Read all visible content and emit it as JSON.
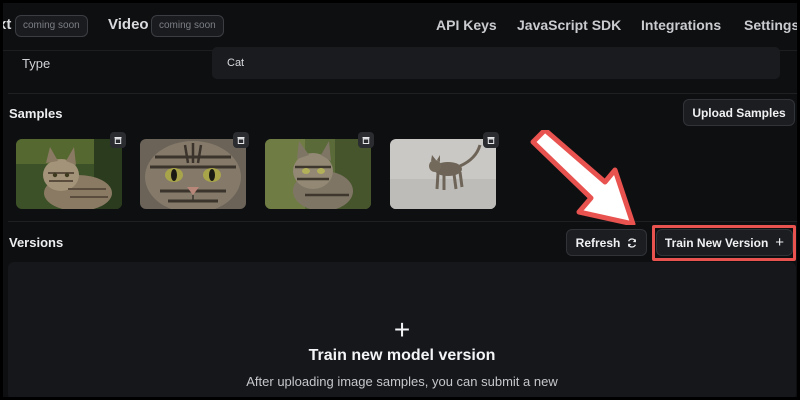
{
  "nav": {
    "partial_tab": "xt",
    "partial_badge": "coming soon",
    "video_tab": "Video",
    "video_badge": "coming soon",
    "links": [
      "API Keys",
      "JavaScript SDK",
      "Integrations",
      "Settings"
    ]
  },
  "type_row": {
    "label": "Type",
    "value": "Cat"
  },
  "samples": {
    "title": "Samples",
    "upload_label": "Upload Samples",
    "images": [
      "tabby-cat-on-grass",
      "tabby-cat-closeup-face",
      "tabby-cat-outdoors",
      "tabby-cat-walking-on-pavement"
    ]
  },
  "versions": {
    "title": "Versions",
    "refresh_label": "Refresh",
    "train_label": "Train New Version",
    "empty_title": "Train new model version",
    "empty_desc": "After uploading image samples, you can submit a new"
  },
  "colors": {
    "highlight": "#e8524f",
    "background": "#0e0f11"
  }
}
